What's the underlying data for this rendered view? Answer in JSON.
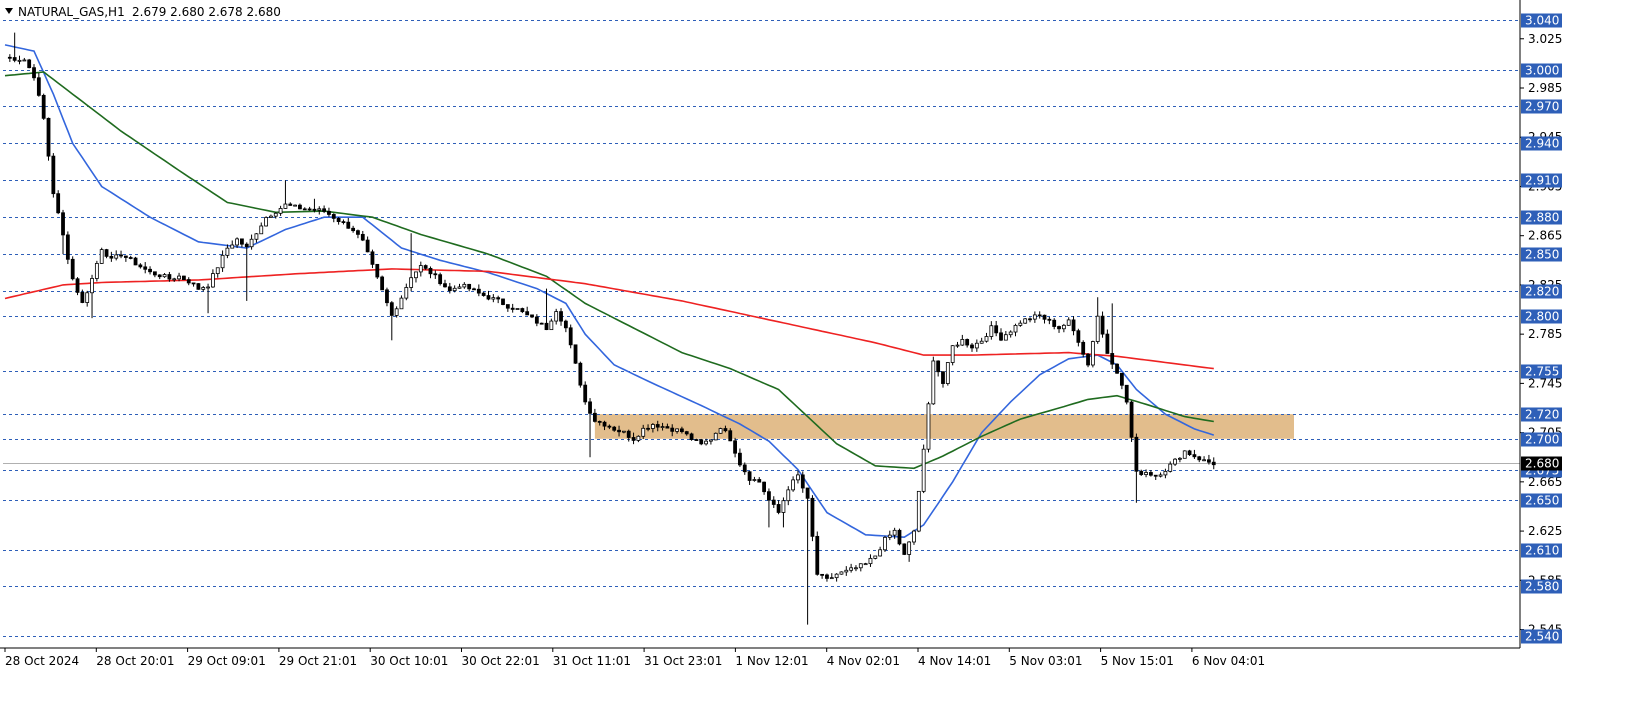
{
  "header": {
    "symbol": "NATURAL_GAS,H1",
    "ohlc": "2.679 2.680 2.678 2.680"
  },
  "colors": {
    "bull_body": "#ffffff",
    "bear_body": "#000000",
    "candle_edge": "#000000",
    "ma_blue": "#3366dd",
    "ma_green": "#1f6b1f",
    "ma_red": "#ee2222",
    "zone": "#dfb67f",
    "grid": "#2e5fb8",
    "badge": "#2e5fb8",
    "current_badge": "#000000"
  },
  "chart_data": {
    "type": "candlestick",
    "symbol": "NATURAL_GAS",
    "timeframe": "H1",
    "ylim": [
      2.53,
      3.05
    ],
    "y_ticks": [
      3.025,
      2.985,
      2.945,
      2.905,
      2.865,
      2.825,
      2.785,
      2.745,
      2.705,
      2.665,
      2.625,
      2.585,
      2.545
    ],
    "levels": [
      3.04,
      3.0,
      2.97,
      2.94,
      2.91,
      2.88,
      2.85,
      2.82,
      2.8,
      2.755,
      2.72,
      2.7,
      2.675,
      2.65,
      2.61,
      2.58,
      2.54
    ],
    "current_price": 2.68,
    "x_labels": [
      "28 Oct 2024",
      "28 Oct 20:01",
      "29 Oct 09:01",
      "29 Oct 21:01",
      "30 Oct 10:01",
      "30 Oct 22:01",
      "31 Oct 11:01",
      "31 Oct 23:01",
      "1 Nov 12:01",
      "4 Nov 02:01",
      "4 Nov 14:01",
      "5 Nov 03:01",
      "5 Nov 15:01",
      "6 Nov 04:01"
    ],
    "zone": {
      "low": 2.7,
      "high": 2.72
    },
    "close_path": [
      [
        0,
        3.01
      ],
      [
        4,
        3.008
      ],
      [
        6,
        2.995
      ],
      [
        8,
        2.96
      ],
      [
        10,
        2.9
      ],
      [
        12,
        2.865
      ],
      [
        14,
        2.83
      ],
      [
        16,
        2.81
      ],
      [
        18,
        2.83
      ],
      [
        20,
        2.855
      ],
      [
        22,
        2.845
      ],
      [
        24,
        2.85
      ],
      [
        26,
        2.845
      ],
      [
        28,
        2.84
      ],
      [
        30,
        2.835
      ],
      [
        32,
        2.833
      ],
      [
        34,
        2.83
      ],
      [
        36,
        2.832
      ],
      [
        38,
        2.828
      ],
      [
        40,
        2.822
      ],
      [
        42,
        2.825
      ],
      [
        44,
        2.84
      ],
      [
        46,
        2.855
      ],
      [
        48,
        2.862
      ],
      [
        50,
        2.855
      ],
      [
        52,
        2.868
      ],
      [
        54,
        2.88
      ],
      [
        56,
        2.885
      ],
      [
        58,
        2.89
      ],
      [
        60,
        2.888
      ],
      [
        62,
        2.887
      ],
      [
        64,
        2.886
      ],
      [
        66,
        2.885
      ],
      [
        68,
        2.88
      ],
      [
        70,
        2.875
      ],
      [
        72,
        2.87
      ],
      [
        74,
        2.86
      ],
      [
        76,
        2.84
      ],
      [
        78,
        2.82
      ],
      [
        80,
        2.8
      ],
      [
        82,
        2.815
      ],
      [
        84,
        2.832
      ],
      [
        86,
        2.84
      ],
      [
        88,
        2.835
      ],
      [
        90,
        2.828
      ],
      [
        92,
        2.82
      ],
      [
        94,
        2.825
      ],
      [
        96,
        2.822
      ],
      [
        98,
        2.818
      ],
      [
        100,
        2.815
      ],
      [
        102,
        2.812
      ],
      [
        104,
        2.808
      ],
      [
        106,
        2.805
      ],
      [
        108,
        2.8
      ],
      [
        110,
        2.795
      ],
      [
        112,
        2.79
      ],
      [
        114,
        2.805
      ],
      [
        116,
        2.79
      ],
      [
        118,
        2.76
      ],
      [
        120,
        2.73
      ],
      [
        122,
        2.715
      ],
      [
        124,
        2.712
      ],
      [
        126,
        2.708
      ],
      [
        128,
        2.705
      ],
      [
        130,
        2.7
      ],
      [
        132,
        2.708
      ],
      [
        134,
        2.712
      ],
      [
        136,
        2.71
      ],
      [
        138,
        2.708
      ],
      [
        140,
        2.706
      ],
      [
        142,
        2.7
      ],
      [
        144,
        2.695
      ],
      [
        146,
        2.7
      ],
      [
        148,
        2.71
      ],
      [
        150,
        2.7
      ],
      [
        152,
        2.68
      ],
      [
        154,
        2.668
      ],
      [
        156,
        2.665
      ],
      [
        158,
        2.65
      ],
      [
        160,
        2.64
      ],
      [
        162,
        2.66
      ],
      [
        164,
        2.67
      ],
      [
        166,
        2.65
      ],
      [
        168,
        2.59
      ],
      [
        170,
        2.585
      ],
      [
        172,
        2.59
      ],
      [
        174,
        2.592
      ],
      [
        176,
        2.595
      ],
      [
        178,
        2.598
      ],
      [
        180,
        2.605
      ],
      [
        182,
        2.618
      ],
      [
        184,
        2.625
      ],
      [
        186,
        2.605
      ],
      [
        188,
        2.625
      ],
      [
        190,
        2.69
      ],
      [
        192,
        2.765
      ],
      [
        194,
        2.745
      ],
      [
        196,
        2.775
      ],
      [
        198,
        2.78
      ],
      [
        200,
        2.775
      ],
      [
        202,
        2.78
      ],
      [
        204,
        2.79
      ],
      [
        206,
        2.782
      ],
      [
        208,
        2.788
      ],
      [
        210,
        2.795
      ],
      [
        212,
        2.798
      ],
      [
        214,
        2.8
      ],
      [
        216,
        2.795
      ],
      [
        218,
        2.79
      ],
      [
        220,
        2.795
      ],
      [
        222,
        2.78
      ],
      [
        224,
        2.76
      ],
      [
        226,
        2.8
      ],
      [
        228,
        2.77
      ],
      [
        230,
        2.755
      ],
      [
        232,
        2.73
      ],
      [
        234,
        2.672
      ],
      [
        236,
        2.673
      ],
      [
        238,
        2.67
      ],
      [
        240,
        2.675
      ],
      [
        242,
        2.682
      ],
      [
        244,
        2.69
      ],
      [
        246,
        2.686
      ],
      [
        248,
        2.682
      ],
      [
        250,
        2.68
      ]
    ],
    "wick_spikes": [
      [
        2,
        3.03
      ],
      [
        12,
        2.85
      ],
      [
        18,
        2.798
      ],
      [
        42,
        2.802
      ],
      [
        50,
        2.812
      ],
      [
        58,
        2.91
      ],
      [
        64,
        2.895
      ],
      [
        80,
        2.78
      ],
      [
        84,
        2.867
      ],
      [
        112,
        2.822
      ],
      [
        121,
        2.685
      ],
      [
        158,
        2.628
      ],
      [
        161,
        2.628
      ],
      [
        166,
        2.549
      ],
      [
        187,
        2.6
      ],
      [
        226,
        2.815
      ],
      [
        229,
        2.81
      ],
      [
        234,
        2.648
      ]
    ],
    "series": [
      {
        "color": "blue",
        "points": [
          [
            0,
            3.02
          ],
          [
            6,
            3.015
          ],
          [
            10,
            2.98
          ],
          [
            14,
            2.94
          ],
          [
            20,
            2.905
          ],
          [
            30,
            2.88
          ],
          [
            40,
            2.86
          ],
          [
            50,
            2.855
          ],
          [
            58,
            2.87
          ],
          [
            66,
            2.88
          ],
          [
            74,
            2.88
          ],
          [
            82,
            2.855
          ],
          [
            90,
            2.845
          ],
          [
            100,
            2.835
          ],
          [
            110,
            2.822
          ],
          [
            116,
            2.81
          ],
          [
            120,
            2.785
          ],
          [
            126,
            2.76
          ],
          [
            134,
            2.745
          ],
          [
            144,
            2.727
          ],
          [
            152,
            2.712
          ],
          [
            158,
            2.698
          ],
          [
            164,
            2.675
          ],
          [
            170,
            2.64
          ],
          [
            178,
            2.622
          ],
          [
            186,
            2.62
          ],
          [
            190,
            2.63
          ],
          [
            196,
            2.665
          ],
          [
            202,
            2.705
          ],
          [
            208,
            2.73
          ],
          [
            214,
            2.752
          ],
          [
            220,
            2.765
          ],
          [
            226,
            2.768
          ],
          [
            230,
            2.76
          ],
          [
            234,
            2.74
          ],
          [
            240,
            2.72
          ],
          [
            246,
            2.708
          ],
          [
            250,
            2.703
          ]
        ]
      },
      {
        "color": "green",
        "points": [
          [
            0,
            2.995
          ],
          [
            8,
            2.998
          ],
          [
            14,
            2.98
          ],
          [
            24,
            2.95
          ],
          [
            36,
            2.918
          ],
          [
            46,
            2.892
          ],
          [
            56,
            2.884
          ],
          [
            66,
            2.885
          ],
          [
            76,
            2.88
          ],
          [
            86,
            2.866
          ],
          [
            100,
            2.85
          ],
          [
            112,
            2.832
          ],
          [
            120,
            2.81
          ],
          [
            130,
            2.79
          ],
          [
            140,
            2.77
          ],
          [
            150,
            2.757
          ],
          [
            160,
            2.74
          ],
          [
            166,
            2.718
          ],
          [
            172,
            2.696
          ],
          [
            180,
            2.678
          ],
          [
            188,
            2.676
          ],
          [
            194,
            2.686
          ],
          [
            202,
            2.702
          ],
          [
            210,
            2.716
          ],
          [
            218,
            2.725
          ],
          [
            224,
            2.732
          ],
          [
            230,
            2.735
          ],
          [
            236,
            2.728
          ],
          [
            244,
            2.718
          ],
          [
            250,
            2.714
          ]
        ]
      },
      {
        "color": "red",
        "points": [
          [
            0,
            2.814
          ],
          [
            12,
            2.825
          ],
          [
            20,
            2.827
          ],
          [
            40,
            2.829
          ],
          [
            60,
            2.834
          ],
          [
            80,
            2.838
          ],
          [
            100,
            2.836
          ],
          [
            120,
            2.826
          ],
          [
            140,
            2.812
          ],
          [
            160,
            2.795
          ],
          [
            180,
            2.778
          ],
          [
            190,
            2.768
          ],
          [
            200,
            2.768
          ],
          [
            220,
            2.77
          ],
          [
            230,
            2.767
          ],
          [
            240,
            2.762
          ],
          [
            250,
            2.757
          ]
        ]
      }
    ]
  }
}
